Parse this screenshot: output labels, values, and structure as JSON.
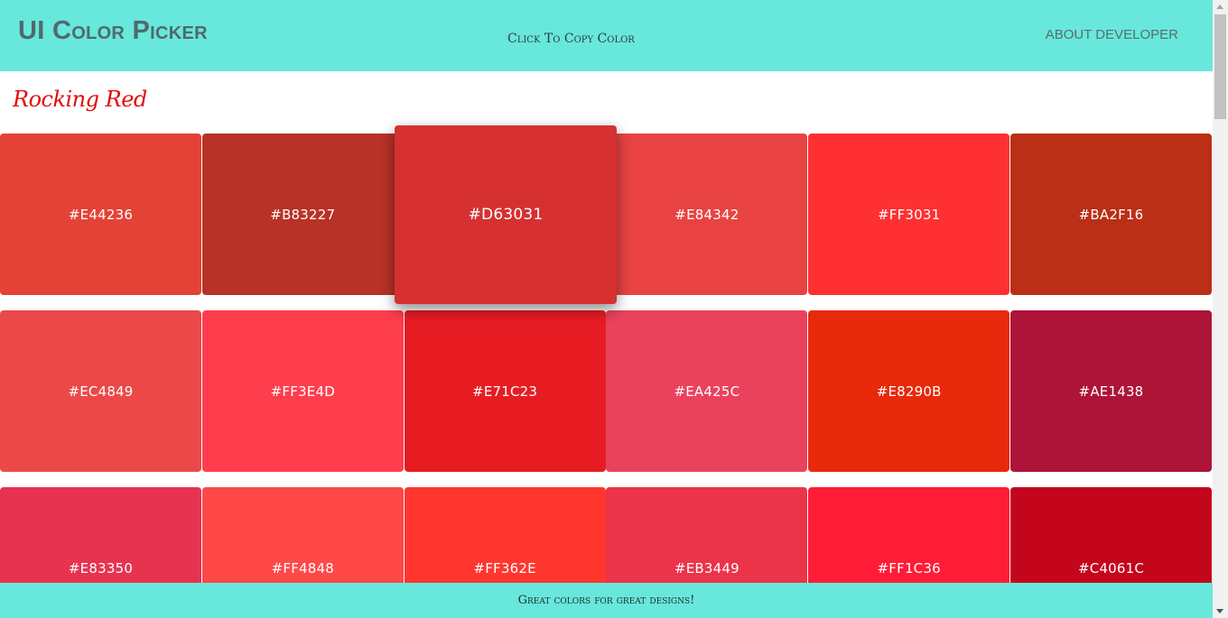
{
  "header": {
    "brand": "UI Color Picker",
    "tagline": "Click To Copy Color",
    "about": "ABOUT DEVELOPER"
  },
  "section": {
    "title": "Rocking Red"
  },
  "swatches": [
    {
      "hex": "#E44236",
      "color": "#E44236"
    },
    {
      "hex": "#B83227",
      "color": "#B83227"
    },
    {
      "hex": "#D63031",
      "color": "#D63031",
      "active": true
    },
    {
      "hex": "#E84342",
      "color": "#E84342"
    },
    {
      "hex": "#FF3031",
      "color": "#FF3031"
    },
    {
      "hex": "#BA2F16",
      "color": "#BA2F16"
    },
    {
      "hex": "#EC4849",
      "color": "#EC4849"
    },
    {
      "hex": "#FF3E4D",
      "color": "#FF3E4D"
    },
    {
      "hex": "#E71C23",
      "color": "#E71C23"
    },
    {
      "hex": "#EA425C",
      "color": "#EA425C"
    },
    {
      "hex": "#E8290B",
      "color": "#E8290B"
    },
    {
      "hex": "#AE1438",
      "color": "#AE1438"
    },
    {
      "hex": "#E83350",
      "color": "#E83350"
    },
    {
      "hex": "#FF4848",
      "color": "#FF4848"
    },
    {
      "hex": "#FF362E",
      "color": "#FF362E"
    },
    {
      "hex": "#EB3449",
      "color": "#EB3449"
    },
    {
      "hex": "#FF1C36",
      "color": "#FF1C36"
    },
    {
      "hex": "#C4061C",
      "color": "#C4061C"
    }
  ],
  "footer": {
    "text": "Great colors for great designs!"
  },
  "colors": {
    "header_bg": "#68E7DC",
    "title_red": "#E10B0B"
  }
}
